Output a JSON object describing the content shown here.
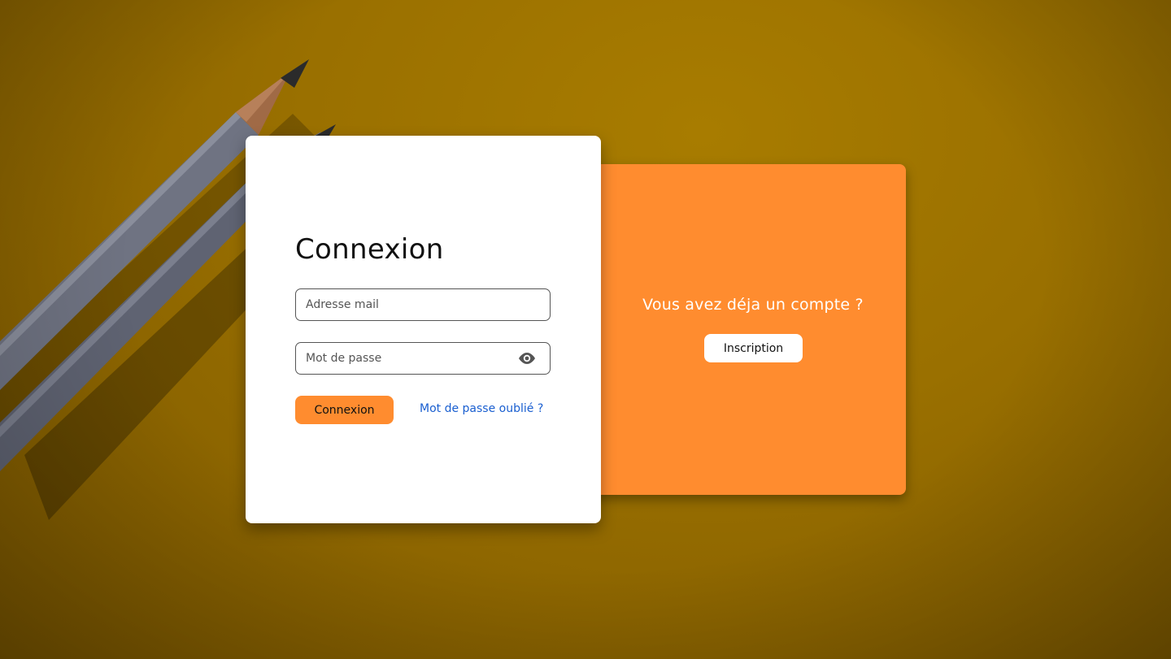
{
  "login": {
    "title": "Connexion",
    "email_placeholder": "Adresse mail",
    "password_placeholder": "Mot de passe",
    "submit_label": "Connexion",
    "forgot_label": "Mot de passe oublié ?"
  },
  "side_panel": {
    "message": "Vous avez déja un compte ?",
    "signup_label": "Inscription"
  },
  "icons": {
    "password_toggle": "eye-icon"
  },
  "colors": {
    "accent": "#ff8c2f",
    "link": "#1a5fd0",
    "background": "#9a7000"
  }
}
